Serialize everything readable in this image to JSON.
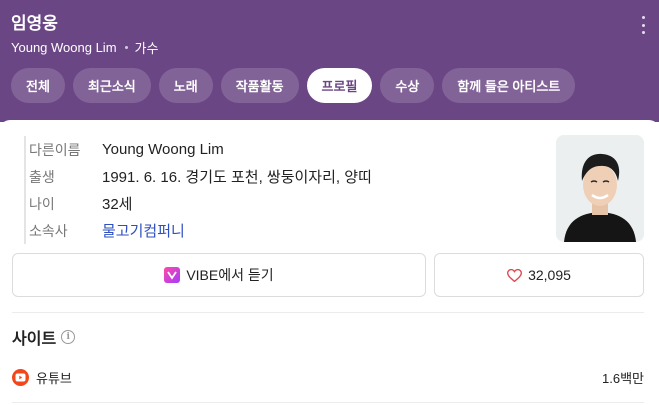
{
  "header": {
    "name": "임영웅",
    "english_name": "Young Woong Lim",
    "role": "가수",
    "more_icon": "more-vertical-icon",
    "background_color": "#6b4685"
  },
  "tabs": [
    {
      "label": "전체",
      "active": false
    },
    {
      "label": "최근소식",
      "active": false
    },
    {
      "label": "노래",
      "active": false
    },
    {
      "label": "작품활동",
      "active": false
    },
    {
      "label": "프로필",
      "active": true
    },
    {
      "label": "수상",
      "active": false
    },
    {
      "label": "함께 들은 아티스트",
      "active": false
    }
  ],
  "profile": {
    "rows": [
      {
        "label": "다른이름",
        "value": "Young Woong Lim",
        "link": false
      },
      {
        "label": "출생",
        "value": "1991. 6. 16. 경기도 포천, 쌍둥이자리, 양띠",
        "link": false
      },
      {
        "label": "나이",
        "value": "32세",
        "link": false
      },
      {
        "label": "소속사",
        "value": "물고기컴퍼니",
        "link": true
      }
    ],
    "link_color": "#2e4fc1"
  },
  "actions": {
    "vibe_label": "VIBE에서 듣기",
    "like_count": "32,095",
    "heart_color": "#e0474c"
  },
  "sites": {
    "title": "사이트",
    "items": [
      {
        "name": "유튜브",
        "count": "1.6백만",
        "icon": "youtube-icon",
        "icon_color": "#f2471c"
      }
    ]
  }
}
